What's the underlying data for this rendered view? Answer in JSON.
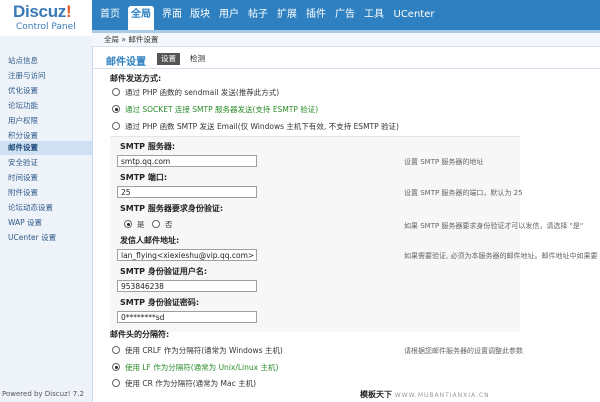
{
  "logo": {
    "brand_main": "Discuz",
    "brand_mark": "!",
    "subtitle": "Control Panel"
  },
  "topnav": [
    "首页",
    "全局",
    "界面",
    "版块",
    "用户",
    "帖子",
    "扩展",
    "插件",
    "广告",
    "工具",
    "UCenter"
  ],
  "sidebar": [
    "站点信息",
    "注册与访问",
    "优化设置",
    "论坛功能",
    "用户权限",
    "积分设置",
    "邮件设置",
    "安全验证",
    "时间设置",
    "附件设置",
    "论坛动态设置",
    "WAP 设置",
    "UCenter 设置"
  ],
  "footer": "Powered by Discuz! 7.2",
  "breadcrumb": "全局 » 邮件设置",
  "page": {
    "title": "邮件设置",
    "tab_settings": "设置",
    "tab_check": "检测"
  },
  "send_method": {
    "label": "邮件发送方式:",
    "options": [
      "通过 PHP 函数的 sendmail 发送(推荐此方式)",
      "通过 SOCKET 连接 SMTP 服务器发送(支持 ESMTP 验证)",
      "通过 PHP 函数 SMTP 发送 Email(仅 Windows 主机下有效, 不支持 ESMTP 验证)"
    ]
  },
  "smtp_server": {
    "label": "SMTP 服务器:",
    "value": "smtp.qq.com",
    "help": "设置 SMTP 服务器的地址"
  },
  "smtp_port": {
    "label": "SMTP 端口:",
    "value": "25",
    "help": "设置 SMTP 服务器的端口，默认为 25"
  },
  "smtp_auth": {
    "label": "SMTP 服务器要求身份验证:",
    "yes": "是",
    "no": "否",
    "help": "如果 SMTP 服务器要求身份验证才可以发信，请选择 \"是\""
  },
  "sender": {
    "label": "发信人邮件地址:",
    "value": "lan_flying<xiexieshu@vip.qq.com>",
    "help": "如果需要验证, 必须为本服务器的邮件地址。邮件地址中如果要"
  },
  "smtp_user": {
    "label": "SMTP 身份验证用户名:",
    "value": "953846238"
  },
  "smtp_pass": {
    "label": "SMTP 身份验证密码:",
    "value": "0********sd"
  },
  "separator": {
    "label": "邮件头的分隔符:",
    "help": "请根据您邮件服务器的设置调整此参数",
    "options": [
      "使用 CRLF 作为分隔符(通常为 Windows 主机)",
      "使用 LF 作为分隔符(通常为 Unix/Linux 主机)",
      "使用 CR 作为分隔符(通常为 Mac 主机)"
    ]
  },
  "watermark": {
    "main": "模板天下",
    "sub": "WWW.MUBANTIANXIA.CN"
  }
}
